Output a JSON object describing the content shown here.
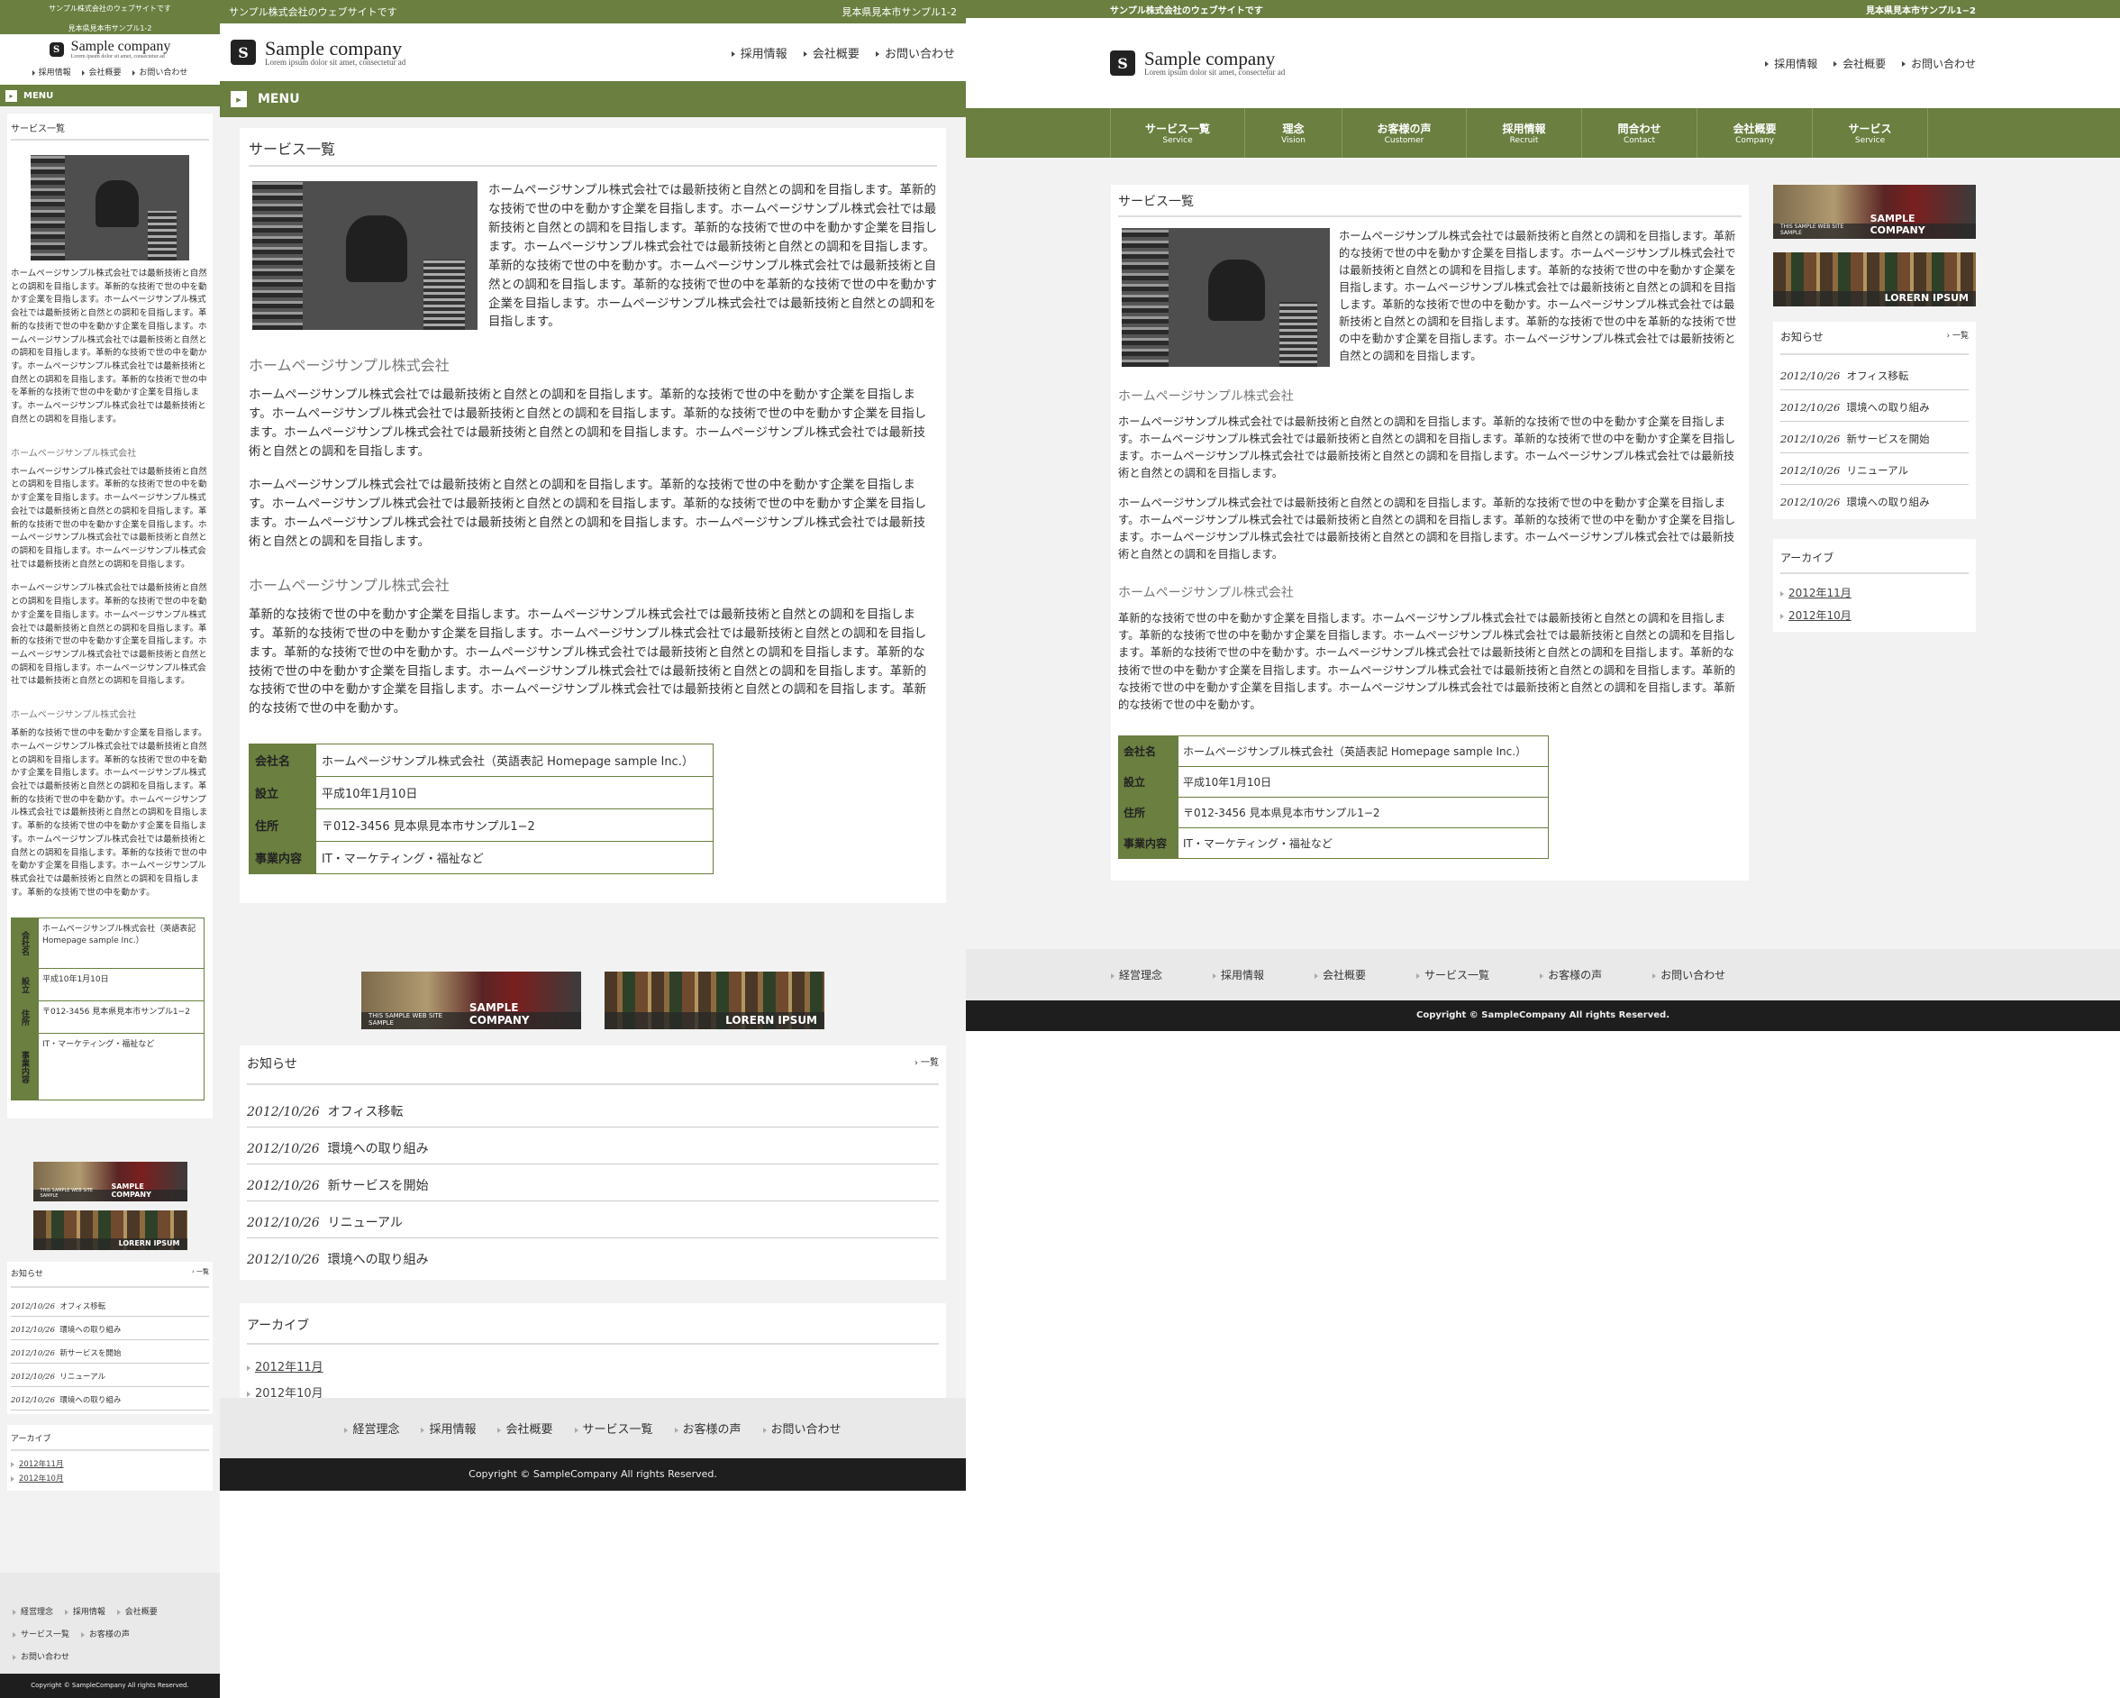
{
  "site": {
    "tagline": "サンプル株式会社のウェブサイトです",
    "address_short": "見本県見本市サンプル1-2",
    "address_short_desktop": "見本県見本市サンプル1−2",
    "logo_name": "Sample company",
    "logo_tagline": "Lorem ipsum dolor sit amet, consectetur ad",
    "logo_mark": "S"
  },
  "header_nav": [
    "採用情報",
    "会社概要",
    "お問い合わせ"
  ],
  "menu_label": "MENU",
  "global_nav": [
    {
      "jp": "サービス一覧",
      "en": "Service"
    },
    {
      "jp": "理念",
      "en": "Vision"
    },
    {
      "jp": "お客様の声",
      "en": "Customer"
    },
    {
      "jp": "採用情報",
      "en": "Recruit"
    },
    {
      "jp": "問合わせ",
      "en": "Contact"
    },
    {
      "jp": "会社概要",
      "en": "Company"
    },
    {
      "jp": "サービス",
      "en": "Service"
    }
  ],
  "main": {
    "title": "サービス一覧",
    "intro": "ホームページサンプル株式会社では最新技術と自然との調和を目指します。革新的な技術で世の中を動かす企業を目指します。ホームページサンプル株式会社では最新技術と自然との調和を目指します。革新的な技術で世の中を動かす企業を目指します。ホームページサンプル株式会社では最新技術と自然との調和を目指します。革新的な技術で世の中を動かす。ホームページサンプル株式会社では最新技術と自然との調和を目指します。革新的な技術で世の中を革新的な技術で世の中を動かす企業を目指します。ホームページサンプル株式会社では最新技術と自然との調和を目指します。",
    "section1_title": "ホームページサンプル株式会社",
    "section1_p1": "ホームページサンプル株式会社では最新技術と自然との調和を目指します。革新的な技術で世の中を動かす企業を目指します。ホームページサンプル株式会社では最新技術と自然との調和を目指します。革新的な技術で世の中を動かす企業を目指します。ホームページサンプル株式会社では最新技術と自然との調和を目指します。ホームページサンプル株式会社では最新技術と自然との調和を目指します。",
    "section1_p2": "ホームページサンプル株式会社では最新技術と自然との調和を目指します。革新的な技術で世の中を動かす企業を目指します。ホームページサンプル株式会社では最新技術と自然との調和を目指します。革新的な技術で世の中を動かす企業を目指します。ホームページサンプル株式会社では最新技術と自然との調和を目指します。ホームページサンプル株式会社では最新技術と自然との調和を目指します。",
    "section2_title": "ホームページサンプル株式会社",
    "section2_p1": "革新的な技術で世の中を動かす企業を目指します。ホームページサンプル株式会社では最新技術と自然との調和を目指します。革新的な技術で世の中を動かす企業を目指します。ホームページサンプル株式会社では最新技術と自然との調和を目指します。革新的な技術で世の中を動かす。ホームページサンプル株式会社では最新技術と自然との調和を目指します。革新的な技術で世の中を動かす企業を目指します。ホームページサンプル株式会社では最新技術と自然との調和を目指します。革新的な技術で世の中を動かす企業を目指します。ホームページサンプル株式会社では最新技術と自然との調和を目指します。革新的な技術で世の中を動かす。"
  },
  "company_table": [
    {
      "label": "会社名",
      "value": "ホームページサンプル株式会社（英語表記 Homepage sample Inc.）"
    },
    {
      "label": "設立",
      "value": "平成10年1月10日"
    },
    {
      "label": "住所",
      "value": "〒012-3456 見本県見本市サンプル1−2"
    },
    {
      "label": "事業内容",
      "value": "IT・マーケティング・福祉など"
    }
  ],
  "banners": [
    {
      "small": "THIS SAMPLE WEB SITE SAMPLE",
      "big": "SAMPLE COMPANY"
    },
    {
      "small": "",
      "big": "LORERN IPSUM"
    }
  ],
  "news": {
    "title": "お知らせ",
    "more": "一覧",
    "items": [
      {
        "date": "2012/10/26",
        "text": "オフィス移転"
      },
      {
        "date": "2012/10/26",
        "text": "環境への取り組み"
      },
      {
        "date": "2012/10/26",
        "text": "新サービスを開始"
      },
      {
        "date": "2012/10/26",
        "text": "リニューアル"
      },
      {
        "date": "2012/10/26",
        "text": "環境への取り組み"
      }
    ]
  },
  "archive": {
    "title": "アーカイブ",
    "items": [
      "2012年11月",
      "2012年10月"
    ]
  },
  "footer_nav": [
    "経営理念",
    "採用情報",
    "会社概要",
    "サービス一覧",
    "お客様の声",
    "お問い合わせ"
  ],
  "copyright": "Copyright © SampleCompany All rights Reserved.",
  "colors": {
    "brand_green": "#6a7f40",
    "footer_dark": "#1e1e1e",
    "page_bg": "#f2f2f2"
  }
}
